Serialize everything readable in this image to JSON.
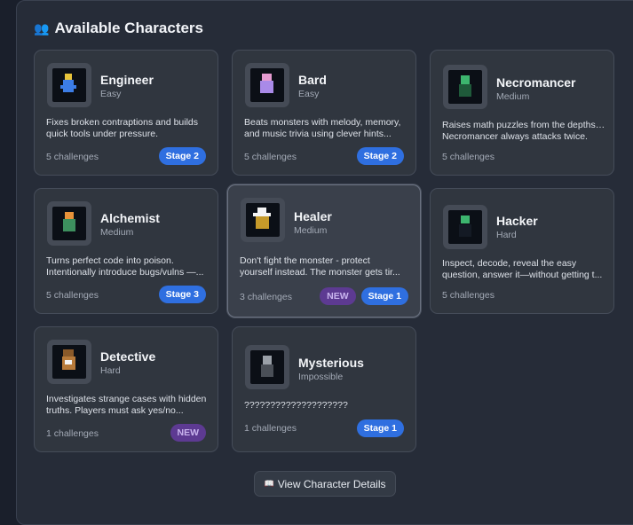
{
  "header": {
    "icon": "👥",
    "title": "Available Characters"
  },
  "characters": [
    {
      "name": "Engineer",
      "difficulty": "Easy",
      "desc1": "Fixes broken contraptions and builds",
      "desc2": "quick tools under pressure.",
      "challenges": "5 challenges",
      "new_label": "",
      "stage_label": "Stage 2"
    },
    {
      "name": "Bard",
      "difficulty": "Easy",
      "desc1": "Beats monsters with melody, memory,",
      "desc2": "and music trivia using clever hints...",
      "challenges": "5 challenges",
      "new_label": "",
      "stage_label": "Stage 2"
    },
    {
      "name": "Necromancer",
      "difficulty": "Medium",
      "desc1": "Raises math puzzles from the depths —",
      "desc2": "Necromancer always attacks twice.",
      "challenges": "5 challenges",
      "new_label": "",
      "stage_label": ""
    },
    {
      "name": "Alchemist",
      "difficulty": "Medium",
      "desc1": "Turns perfect code into poison.",
      "desc2": "Intentionally introduce bugs/vulns —...",
      "challenges": "5 challenges",
      "new_label": "",
      "stage_label": "Stage 3"
    },
    {
      "name": "Healer",
      "difficulty": "Medium",
      "desc1": "Don't fight the monster - protect",
      "desc2": "yourself instead. The monster gets tir...",
      "challenges": "3 challenges",
      "new_label": "NEW",
      "stage_label": "Stage 1"
    },
    {
      "name": "Hacker",
      "difficulty": "Hard",
      "desc1": "Inspect, decode, reveal the easy",
      "desc2": "question, answer it—without getting t...",
      "challenges": "5 challenges",
      "new_label": "",
      "stage_label": ""
    },
    {
      "name": "Detective",
      "difficulty": "Hard",
      "desc1": "Investigates strange cases with hidden",
      "desc2": "truths. Players must ask yes/no...",
      "challenges": "1 challenges",
      "new_label": "NEW",
      "stage_label": ""
    },
    {
      "name": "Mysterious",
      "difficulty": "Impossible",
      "desc1": "????????????????????",
      "desc2": "",
      "challenges": "1 challenges",
      "new_label": "",
      "stage_label": "Stage 1"
    }
  ],
  "footer": {
    "icon": "📖",
    "label": "View Character Details"
  },
  "colors": {
    "stage_badge": "#2f6fe0",
    "new_badge": "#5d3a92",
    "card_bg": "#30363f"
  }
}
